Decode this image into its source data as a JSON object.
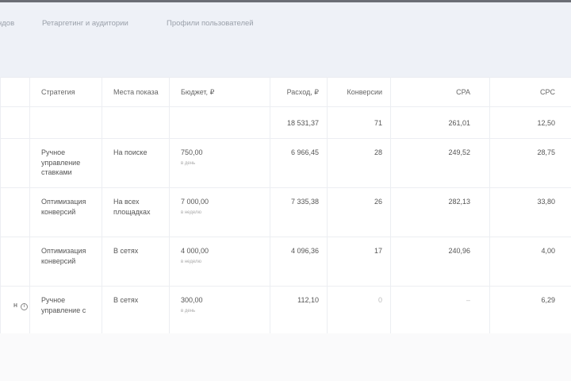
{
  "tabs": [
    "ндов",
    "Ретаргетинг и аудитории",
    "Профили пользователей"
  ],
  "columns": [
    "",
    "Стратегия",
    "Места показа",
    "Бюджет, ₽",
    "Расход, ₽",
    "Конверсии",
    "",
    "CPA",
    "CPC"
  ],
  "total": {
    "spend": "18 531,37",
    "conversions": "71",
    "cpa": "261,01",
    "cpc": "12,50"
  },
  "rows": [
    {
      "name": "",
      "strategy": "Ручное управление ставками",
      "places": "На поиске",
      "budget": "750,00",
      "period": "в день",
      "spend": "6 966,45",
      "conversions": "28",
      "cpa": "249,52",
      "cpc": "28,75"
    },
    {
      "name": "",
      "strategy": "Оптимизация конверсий",
      "places": "На всех площадках",
      "budget": "7 000,00",
      "period": "в неделю",
      "spend": "7 335,38",
      "conversions": "26",
      "cpa": "282,13",
      "cpc": "33,80"
    },
    {
      "name": "",
      "strategy": "Оптимизация конверсий",
      "places": "В сетях",
      "budget": "4 000,00",
      "period": "в неделю",
      "spend": "4 096,36",
      "conversions": "17",
      "cpa": "240,96",
      "cpc": "4,00"
    },
    {
      "name": "н",
      "strategy": "Ручное управление с",
      "places": "В сетях",
      "budget": "300,00",
      "period": "в день",
      "spend": "112,10",
      "conversions": "0",
      "cpa": "–",
      "cpc": "6,29"
    }
  ]
}
